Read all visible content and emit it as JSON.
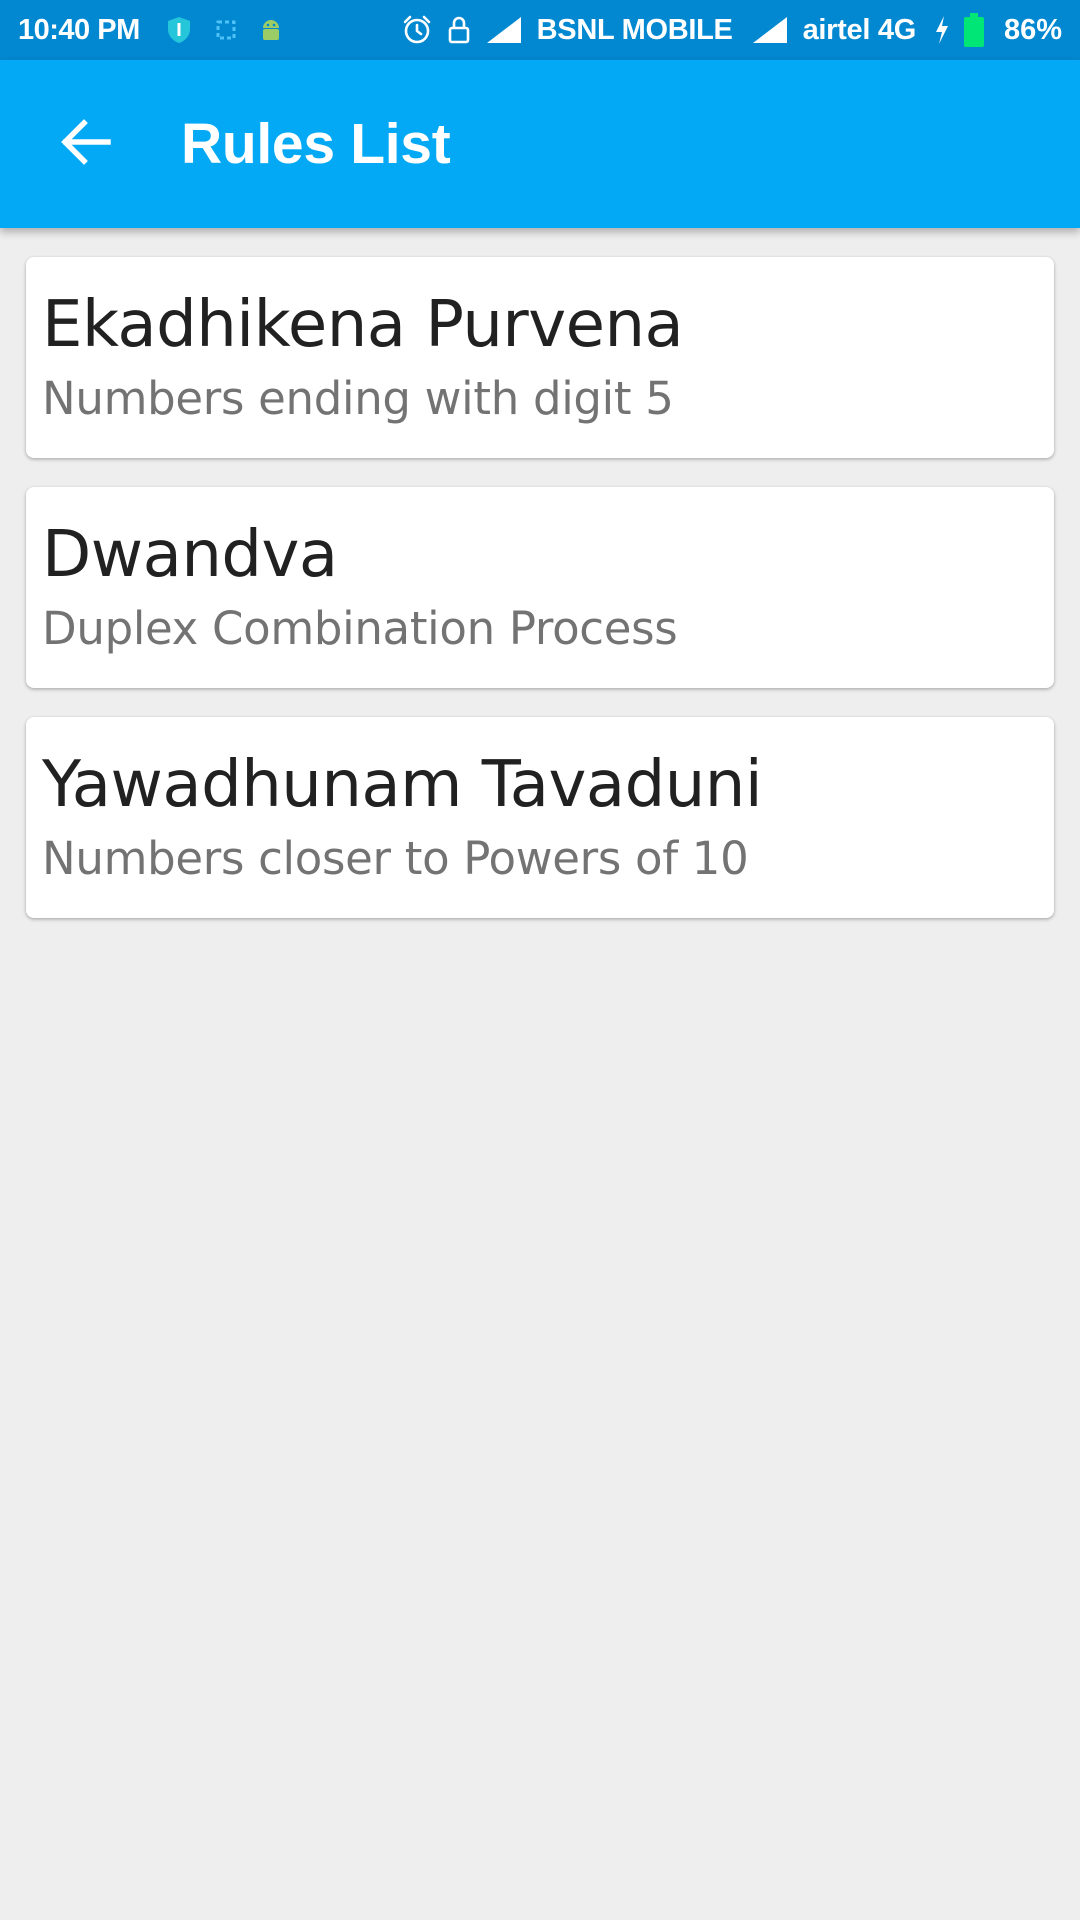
{
  "status_bar": {
    "time": "10:40 PM",
    "carrier_1": "BSNL MOBILE",
    "carrier_2": "airtel 4G",
    "battery_percent": "86%",
    "icons": [
      "shield-icon",
      "screenshot-icon",
      "android-icon",
      "alarm-icon",
      "lock-icon",
      "signal-icon",
      "charging-icon",
      "battery-icon"
    ],
    "battery_level": 0.86
  },
  "app_bar": {
    "title": "Rules List",
    "back_icon": "arrow-left-icon"
  },
  "rules": [
    {
      "title": "Ekadhikena Purvena",
      "subtitle": "Numbers ending with digit 5"
    },
    {
      "title": "Dwandva",
      "subtitle": "Duplex Combination Process"
    },
    {
      "title": "Yawadhunam Tavaduni",
      "subtitle": "Numbers closer to Powers of 10"
    }
  ],
  "colors": {
    "status_bar": "#0288d1",
    "app_bar": "#03a9f4",
    "background": "#eeeeee",
    "card": "#ffffff",
    "title_text": "#212121",
    "subtitle_text": "#737373",
    "battery_fill": "#00e676"
  }
}
